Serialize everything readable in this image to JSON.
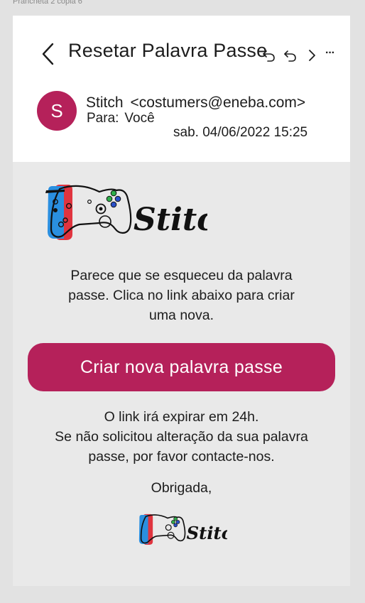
{
  "artboard": {
    "label": "Prancheta 2 cópia 6"
  },
  "header": {
    "subject": "Resetar Palavra Passe",
    "more_label": "···"
  },
  "sender": {
    "avatar_letter": "S",
    "name": "Stitch",
    "email": "<costumers@eneba.com>",
    "to_label": "Para:",
    "to_value": "Você",
    "date": "sab. 04/06/2022 15:25"
  },
  "logo": {
    "text": "Stitch"
  },
  "message": {
    "intro_lines": [
      "Parece que se esqueceu da palavra",
      "passe. Clica no link abaixo para criar",
      "uma nova."
    ],
    "cta_label": "Criar nova palavra passe",
    "expiry_lines": [
      "O link irá expirar em 24h.",
      "Se não solicitou alteração da sua palavra",
      "passe, por favor contacte-nos."
    ],
    "signoff": "Obrigada,"
  },
  "colors": {
    "accent": "#b5215a",
    "joycon_left": "#2a8fe0",
    "joycon_right": "#e0343f",
    "button_green": "#2fae4a",
    "button_blue": "#2a50c8",
    "background": "#e9e9e9"
  },
  "icons": {
    "back": "chevron-left-icon",
    "reply": "reply-icon",
    "reply_all": "reply-all-icon",
    "forward": "forward-icon",
    "more": "more-options-icon"
  }
}
